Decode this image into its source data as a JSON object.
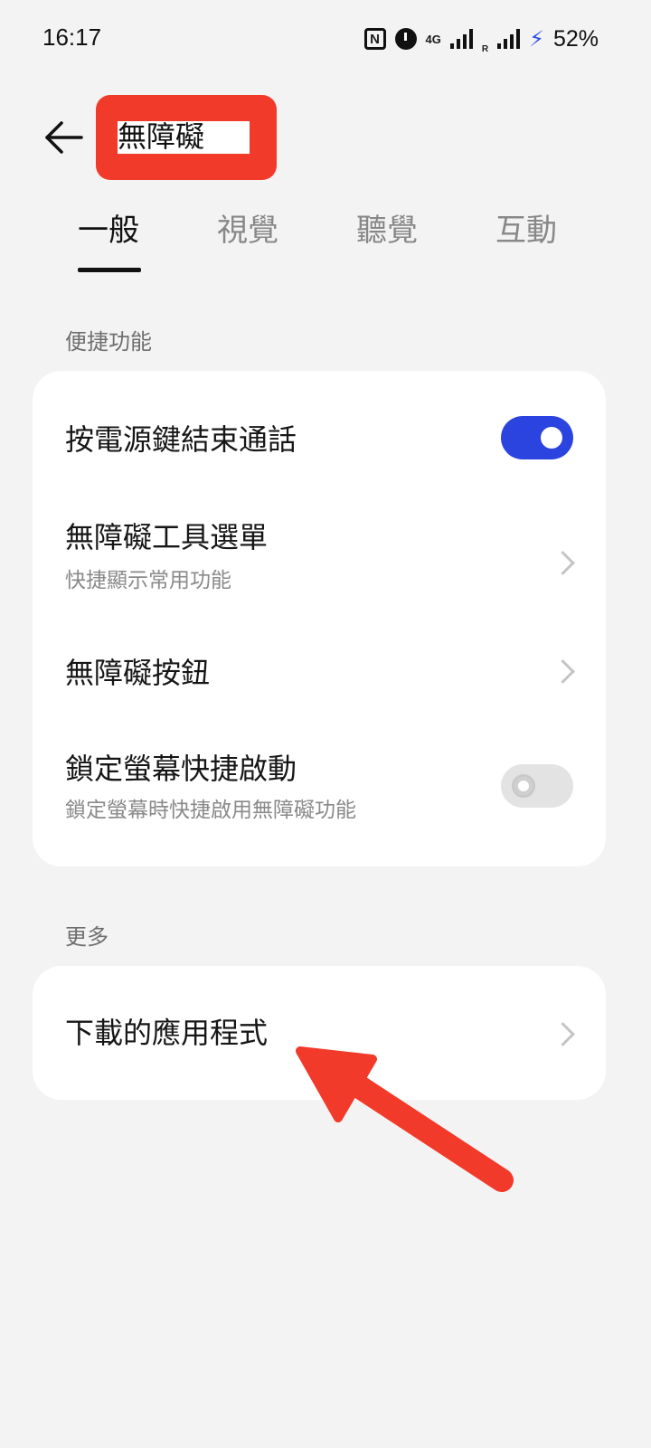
{
  "status_bar": {
    "time": "16:17",
    "network": "4G",
    "roaming": "R",
    "battery": "52%"
  },
  "header": {
    "title": "無障礙"
  },
  "tabs": [
    {
      "label": "一般",
      "active": true
    },
    {
      "label": "視覺",
      "active": false
    },
    {
      "label": "聽覺",
      "active": false
    },
    {
      "label": "互動",
      "active": false
    }
  ],
  "sections": [
    {
      "header": "便捷功能",
      "items": [
        {
          "title": "按電源鍵結束通話",
          "control": "toggle",
          "value": "on"
        },
        {
          "title": "無障礙工具選單",
          "subtitle": "快捷顯示常用功能",
          "control": "chevron"
        },
        {
          "title": "無障礙按鈕",
          "control": "chevron"
        },
        {
          "title": "鎖定螢幕快捷啟動",
          "subtitle": "鎖定螢幕時快捷啟用無障礙功能",
          "control": "toggle",
          "value": "off"
        }
      ]
    },
    {
      "header": "更多",
      "items": [
        {
          "title": "下載的應用程式",
          "control": "chevron"
        }
      ]
    }
  ],
  "colors": {
    "accent": "#2b44e0",
    "highlight": "#f23a2a",
    "background": "#f3f3f3"
  },
  "icons": [
    "nfc-icon",
    "alarm-icon",
    "signal-icon",
    "bolt-icon",
    "back-arrow-icon",
    "chevron-right-icon",
    "annotation-arrow"
  ]
}
